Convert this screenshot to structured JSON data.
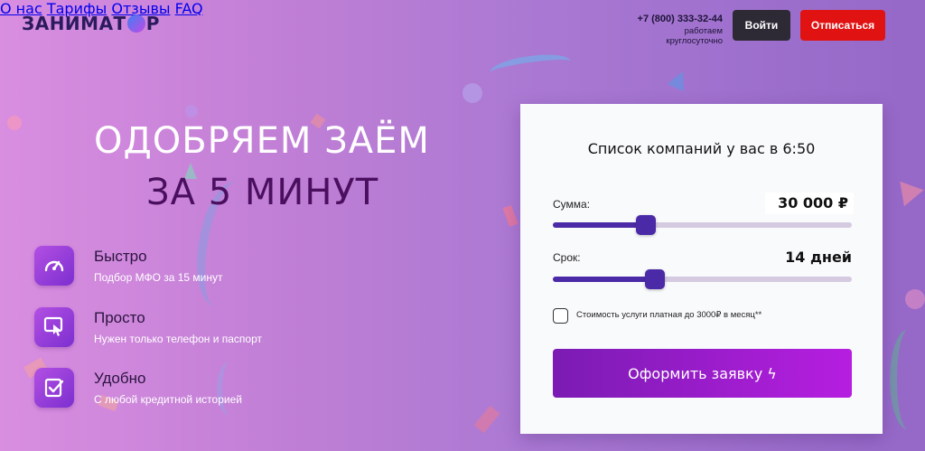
{
  "header": {
    "logo_text_1": "ЗАНИМАТ",
    "logo_text_2": "Р",
    "nav": [
      {
        "label": "О нас"
      },
      {
        "label": "Тарифы"
      },
      {
        "label": "Отзывы"
      },
      {
        "label": "FAQ"
      }
    ],
    "phone": "+7 (800) 333-32-44",
    "phone_note": "работаем круглосуточно",
    "login_label": "Войти",
    "unsubscribe_label": "Отписаться"
  },
  "hero": {
    "line1": "ОДОБРЯЕМ ЗАЁМ",
    "line2": "ЗА 5 МИНУТ"
  },
  "features": [
    {
      "title": "Быстро",
      "desc": "Подбор МФО за 15 минут",
      "icon": "speedometer-icon"
    },
    {
      "title": "Просто",
      "desc": "Нужен только телефон и паспорт",
      "icon": "touch-screen-icon"
    },
    {
      "title": "Удобно",
      "desc": "С любой кредитной историей",
      "icon": "checklist-icon"
    }
  ],
  "form": {
    "title": "Список компаний у вас в 6:50",
    "amount_label": "Сумма:",
    "amount_value": "30 000 ₽",
    "amount_fraction": 0.31,
    "term_label": "Срок:",
    "term_value": "14 дней",
    "term_fraction": 0.34,
    "consent_label": "Стоимость услуги платная до 3000₽ в месяц**",
    "consent_checked": false,
    "submit_label": "Оформить заявку ϟ"
  },
  "colors": {
    "accent": "#4b2aa8",
    "submit_start": "#7b1bb3",
    "submit_end": "#b61ee0",
    "unsubscribe": "#e01212",
    "login": "#2d2a35"
  }
}
